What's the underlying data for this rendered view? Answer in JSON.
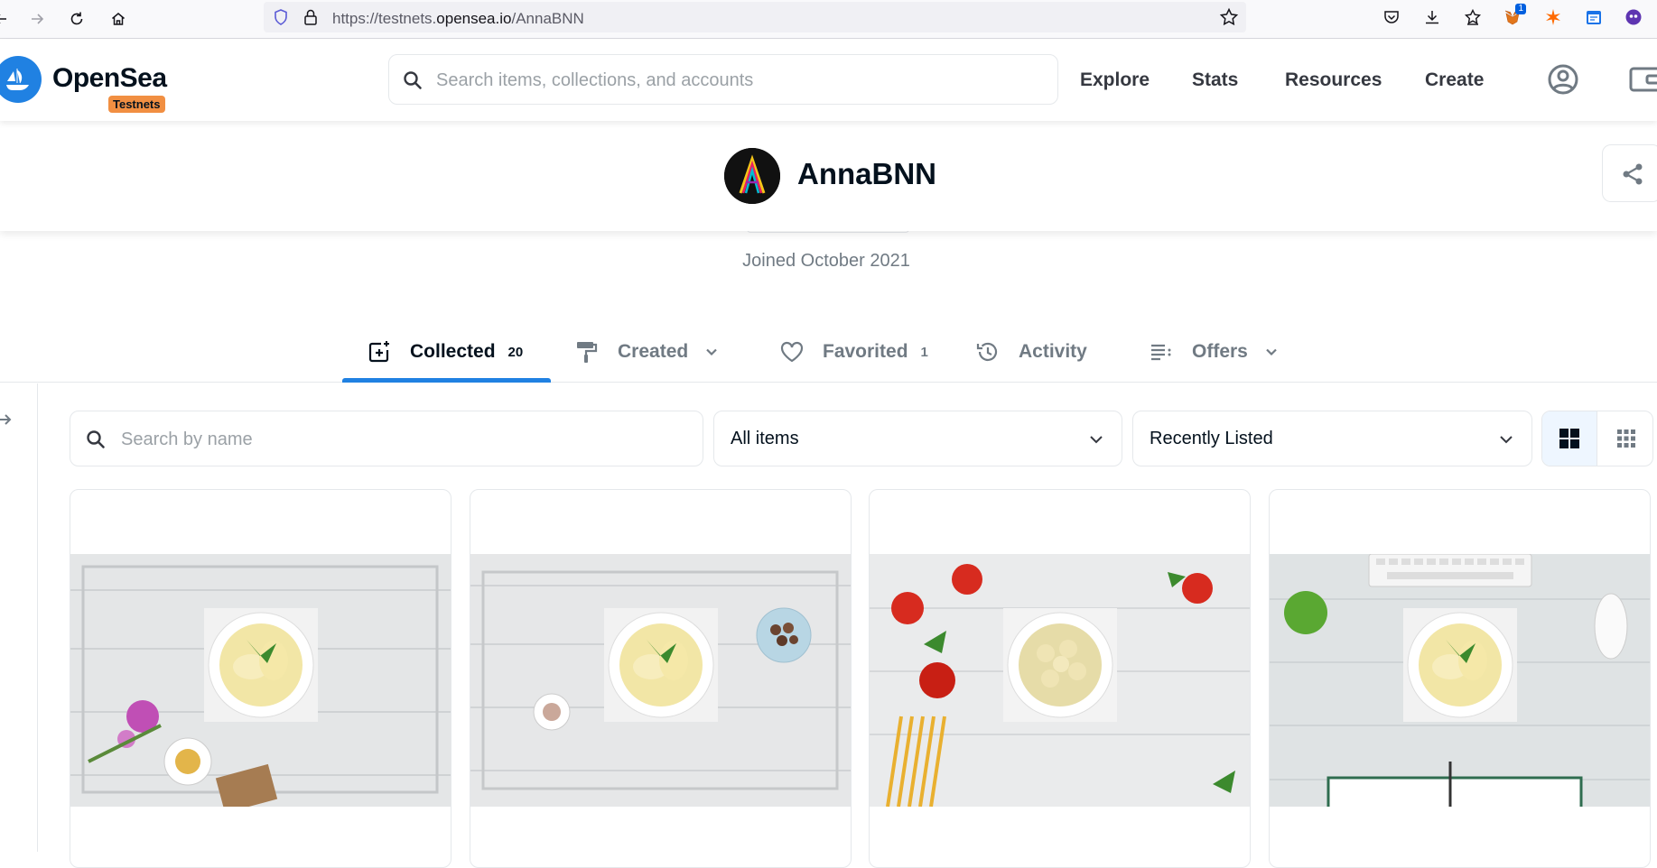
{
  "browser": {
    "url_prefix": "https://testnets.",
    "url_host": "opensea.io",
    "url_path": "/AnnaBNN",
    "ext_badge_count": "1"
  },
  "header": {
    "logo_text": "OpenSea",
    "badge": "Testnets",
    "search_placeholder": "Search items, collections, and accounts",
    "nav": [
      "Explore",
      "Stats",
      "Resources",
      "Create"
    ]
  },
  "profile": {
    "name": "AnnaBNN",
    "joined": "Joined October 2021"
  },
  "tabs": [
    {
      "label": "Collected",
      "count": "20"
    },
    {
      "label": "Created"
    },
    {
      "label": "Favorited",
      "count": "1"
    },
    {
      "label": "Activity"
    },
    {
      "label": "Offers"
    }
  ],
  "filters": {
    "search_placeholder": "Search by name",
    "items_select": "All items",
    "sort_select": "Recently Listed"
  },
  "colors": {
    "brand": "#2081e2",
    "badge": "#f18f42"
  }
}
